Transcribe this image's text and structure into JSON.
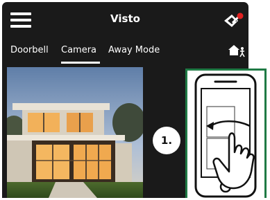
{
  "header": {
    "title": "Visto"
  },
  "tabs": [
    {
      "label": "Doorbell",
      "selected": false
    },
    {
      "label": "Camera",
      "selected": true
    },
    {
      "label": "Away Mode",
      "selected": false
    }
  ],
  "step": {
    "number": "1."
  },
  "icons": {
    "menu": "hamburger-menu-icon",
    "logo": "brand-logo-icon",
    "home": "home-person-icon",
    "gesture": "phone-swipe-gesture-icon"
  },
  "colors": {
    "app_background": "#1a1a1a",
    "notification_dot": "#e02020",
    "instruction_border": "#1f7a45"
  }
}
